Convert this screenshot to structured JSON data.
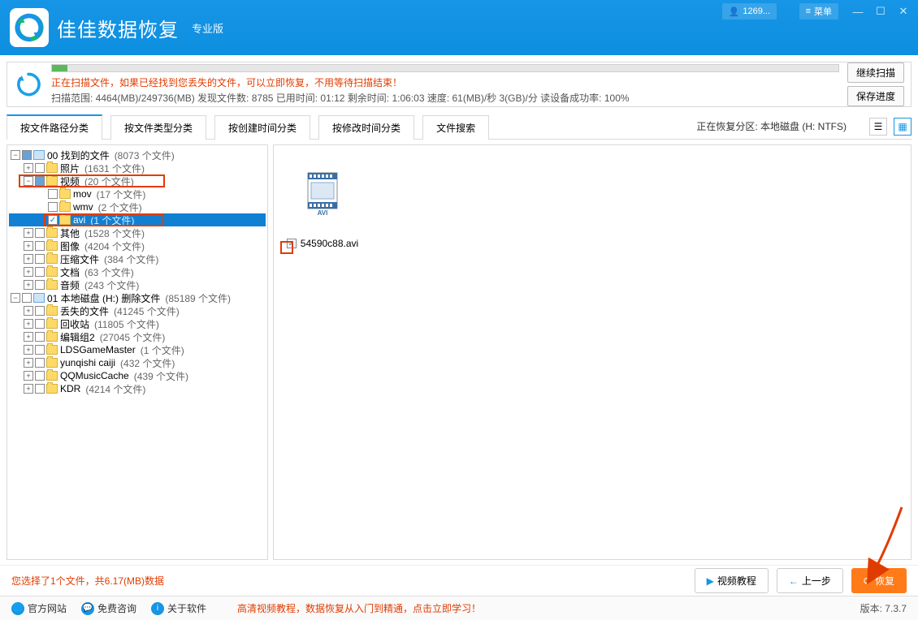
{
  "app": {
    "title": "佳佳数据恢复",
    "edition": "专业版"
  },
  "header": {
    "account": "1269...",
    "menu": "菜单"
  },
  "status": {
    "message": "正在扫描文件，如果已经找到您丢失的文件，可以立即恢复，不用等待扫描结束！",
    "detail": "扫描范围: 4464(MB)/249736(MB)  发现文件数: 8785   已用时间: 01:12   剩余时间: 1:06:03   速度: 61(MB)/秒  3(GB)/分  读设备成功率: 100%",
    "btn_continue": "继续扫描",
    "btn_save": "保存进度"
  },
  "tabs": {
    "t1": "按文件路径分类",
    "t2": "按文件类型分类",
    "t3": "按创建时间分类",
    "t4": "按修改时间分类",
    "t5": "文件搜索",
    "partition": "正在恢复分区: 本地磁盘 (H: NTFS)"
  },
  "tree": {
    "root1": "00 找到的文件",
    "root1_count": "(8073 个文件)",
    "photos": "照片",
    "photos_count": "(1631 个文件)",
    "video": "视频",
    "video_count": "(20 个文件)",
    "mov": "mov",
    "mov_count": "(17 个文件)",
    "wmv": "wmv",
    "wmv_count": "(2 个文件)",
    "avi": "avi",
    "avi_count": "(1 个文件)",
    "other": "其他",
    "other_count": "(1528 个文件)",
    "image": "图像",
    "image_count": "(4204 个文件)",
    "zip": "压缩文件",
    "zip_count": "(384 个文件)",
    "doc": "文档",
    "doc_count": "(63 个文件)",
    "audio": "音频",
    "audio_count": "(243 个文件)",
    "root2": "01 本地磁盘 (H:) 删除文件",
    "root2_count": "(85189 个文件)",
    "lost": "丢失的文件",
    "lost_count": "(41245 个文件)",
    "recycle": "回收站",
    "recycle_count": "(11805 个文件)",
    "edit2": "编辑组2",
    "edit2_count": "(27045 个文件)",
    "lds": "LDSGameMaster",
    "lds_count": "(1 个文件)",
    "yun": "yunqishi caiji",
    "yun_count": "(432 个文件)",
    "qq": "QQMusicCache",
    "qq_count": "(439 个文件)",
    "kdr": "KDR",
    "kdr_count": "(4214 个文件)"
  },
  "file": {
    "name": "54590c88.avi"
  },
  "footer": {
    "selection": "您选择了1个文件，共6.17(MB)数据",
    "btn_tutorial": "视频教程",
    "btn_prev": "上一步",
    "btn_recover": "恢复",
    "link_site": "官方网站",
    "link_consult": "免费咨询",
    "link_about": "关于软件",
    "promo": "高清视频教程，数据恢复从入门到精通，点击立即学习！",
    "version": "版本: 7.3.7"
  }
}
